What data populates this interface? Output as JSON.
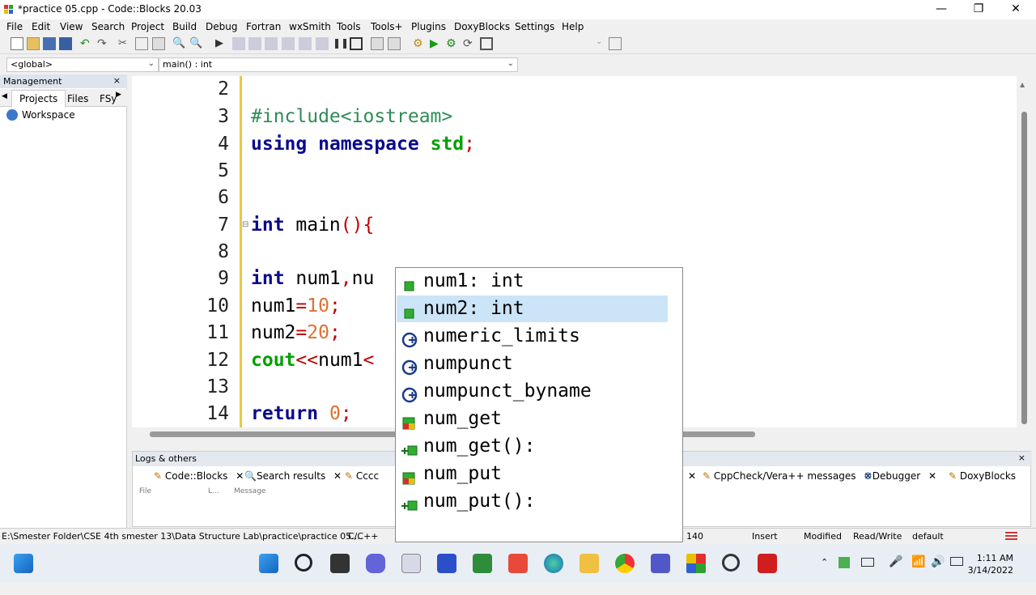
{
  "window": {
    "title": "*practice 05.cpp - Code::Blocks 20.03",
    "minimize": "—",
    "maximize": "❐",
    "close": "✕"
  },
  "menu": [
    "File",
    "Edit",
    "View",
    "Search",
    "Project",
    "Build",
    "Debug",
    "Fortran",
    "wxSmith",
    "Tools",
    "Tools+",
    "Plugins",
    "DoxyBlocks",
    "Settings",
    "Help"
  ],
  "toolbar2": {
    "scope": "<global>",
    "function": "main() : int"
  },
  "management": {
    "title": "Management",
    "close": "×",
    "tabs": [
      "Projects",
      "Files",
      "FSy"
    ],
    "tree_root": "Workspace"
  },
  "editor": {
    "lines": [
      {
        "n": "2",
        "code": ""
      },
      {
        "n": "3",
        "code": "#include<iostream>"
      },
      {
        "n": "4",
        "code": "using namespace std;"
      },
      {
        "n": "5",
        "code": ""
      },
      {
        "n": "6",
        "code": ""
      },
      {
        "n": "7",
        "code": "int main(){"
      },
      {
        "n": "8",
        "code": ""
      },
      {
        "n": "9",
        "code": "int num1,nu"
      },
      {
        "n": "10",
        "code": "num1=10;"
      },
      {
        "n": "11",
        "code": "num2=20;"
      },
      {
        "n": "12",
        "code": "cout<<num1<"
      },
      {
        "n": "13",
        "code": ""
      },
      {
        "n": "14",
        "code": "return 0;"
      }
    ]
  },
  "autocomplete": {
    "items": [
      {
        "text": "num1: int",
        "icon": "variable-icon",
        "selected": false
      },
      {
        "text": "num2: int",
        "icon": "variable-icon",
        "selected": true
      },
      {
        "text": "numeric_limits",
        "icon": "class-icon",
        "selected": false
      },
      {
        "text": "numpunct",
        "icon": "class-icon",
        "selected": false
      },
      {
        "text": "numpunct_byname",
        "icon": "class-icon",
        "selected": false
      },
      {
        "text": "num_get",
        "icon": "typedef-icon",
        "selected": false
      },
      {
        "text": "num_get():",
        "icon": "constructor-icon",
        "selected": false
      },
      {
        "text": "num_put",
        "icon": "typedef-icon",
        "selected": false
      },
      {
        "text": "num_put():",
        "icon": "constructor-icon",
        "selected": false
      }
    ]
  },
  "logs": {
    "title": "Logs & others",
    "close": "×",
    "tabs": [
      "Code::Blocks",
      "Search results",
      "Cccc",
      "CppCheck/Vera++ messages",
      "Debugger",
      "DoxyBlocks"
    ],
    "columns": [
      "File",
      "L...",
      "Message"
    ]
  },
  "status": {
    "path": "E:\\Smester Folder\\CSE 4th smester 13\\Data Structure Lab\\practice\\practice 05....",
    "lang": "C/C++",
    "pos": "140",
    "mode": "Insert",
    "modified": "Modified",
    "access": "Read/Write",
    "profile": "default"
  },
  "clock": {
    "time": "1:11 AM",
    "date": "3/14/2022"
  },
  "colors": {
    "accent": "#0078d7",
    "selection": "#cce4f7",
    "gutter_marker": "#e8c844"
  }
}
